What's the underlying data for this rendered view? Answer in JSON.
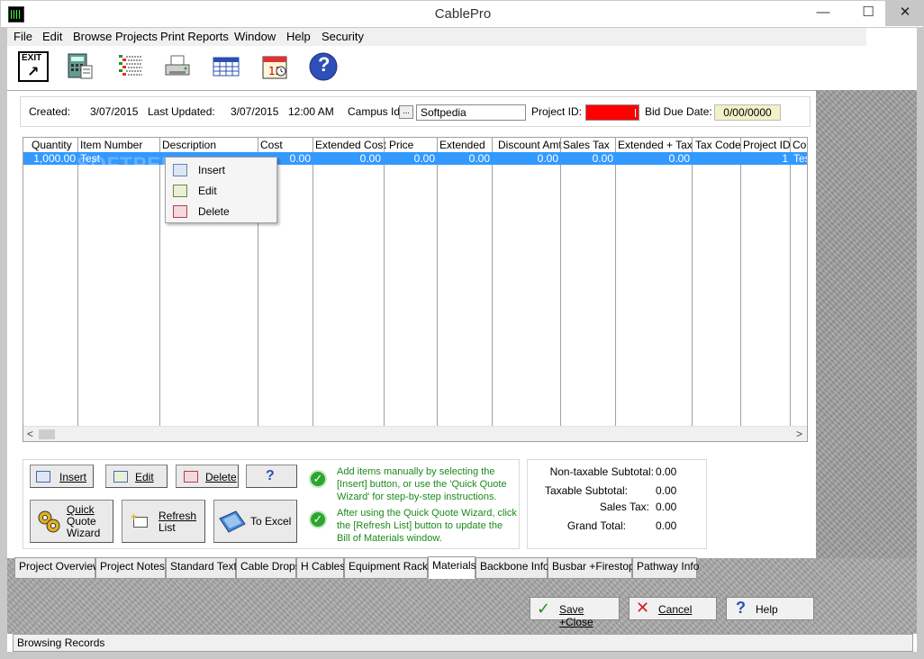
{
  "window": {
    "title": "CablePro",
    "minimize": "—",
    "maximize": "☐",
    "close": "✕"
  },
  "menu": [
    "File",
    "Edit",
    "Browse Projects",
    "Print Reports",
    "Window",
    "Help",
    "Security"
  ],
  "toolbar": {
    "exit_label": "EXIT",
    "icons": [
      "exit-icon",
      "calculator-icon",
      "list-icon",
      "printer-icon",
      "calendar-grid-icon",
      "calendar-icon",
      "help-icon"
    ],
    "help_glyph": "?"
  },
  "info": {
    "created_label": "Created:",
    "created_value": "3/07/2015",
    "updated_label": "Last Updated:",
    "updated_date": "3/07/2015",
    "updated_time": "12:00 AM",
    "campus_label": "Campus Id:",
    "campus_button": "...",
    "campus_value": "Softpedia",
    "project_id_label": "Project ID:",
    "bid_due_label": "Bid Due Date:",
    "bid_due_value": "0/00/0000"
  },
  "grid": {
    "columns": [
      "Quantity",
      "Item Number",
      "Description",
      "Cost",
      "Extended Cost",
      "Price",
      "Extended",
      "Discount Amt",
      "Sales Tax",
      "Extended + Tax",
      "Tax Code",
      "Project ID",
      "Co"
    ],
    "row": {
      "quantity": "1,000.00",
      "item_number": "Test",
      "description": "",
      "cost": "0.00",
      "extended_cost": "0.00",
      "price": "0.00",
      "extended": "0.00",
      "discount_amt": "0.00",
      "sales_tax": "0.00",
      "extended_tax": "0.00",
      "tax_code": "",
      "project_id": "1",
      "co": "Tes"
    },
    "watermark": "SOFTPEDIA"
  },
  "context_menu": {
    "insert": "Insert",
    "edit": "Edit",
    "delete": "Delete"
  },
  "buttons": {
    "insert": "Insert",
    "edit": "Edit",
    "delete": "Delete",
    "help": "?",
    "quick_quote": [
      "Quick",
      "Quote",
      "Wizard"
    ],
    "refresh": [
      "Refresh",
      "List"
    ],
    "to_excel": "To Excel"
  },
  "instructions": [
    "Add items manually by selecting the [Insert] button, or use the 'Quick Quote Wizard' for step-by-step instructions.",
    "After using the Quick Quote Wizard, click the [Refresh List] button to update the Bill of Materials window."
  ],
  "totals": {
    "non_taxable_label": "Non-taxable Subtotal:",
    "non_taxable_value": "0.00",
    "taxable_label": "Taxable Subtotal:",
    "taxable_value": "0.00",
    "sales_tax_label": "Sales Tax:",
    "sales_tax_value": "0.00",
    "grand_total_label": "Grand Total:",
    "grand_total_value": "0.00"
  },
  "tabs": [
    "Project Overview",
    "Project Notes:",
    "Standard Text",
    "Cable Drops",
    "H Cables",
    "Equipment Racks",
    "Materials",
    "Backbone Info",
    "Busbar +Firestops",
    "Pathway Info"
  ],
  "active_tab": "Materials",
  "footer_buttons": {
    "save": "Save +Close",
    "cancel": "Cancel",
    "help": "Help"
  },
  "status": "Browsing Records",
  "colors": {
    "selection": "#3399ff",
    "project_id_bg": "#ff0000",
    "instruction_text": "#1b8a1b",
    "ok_icon": "#2ea52e"
  }
}
